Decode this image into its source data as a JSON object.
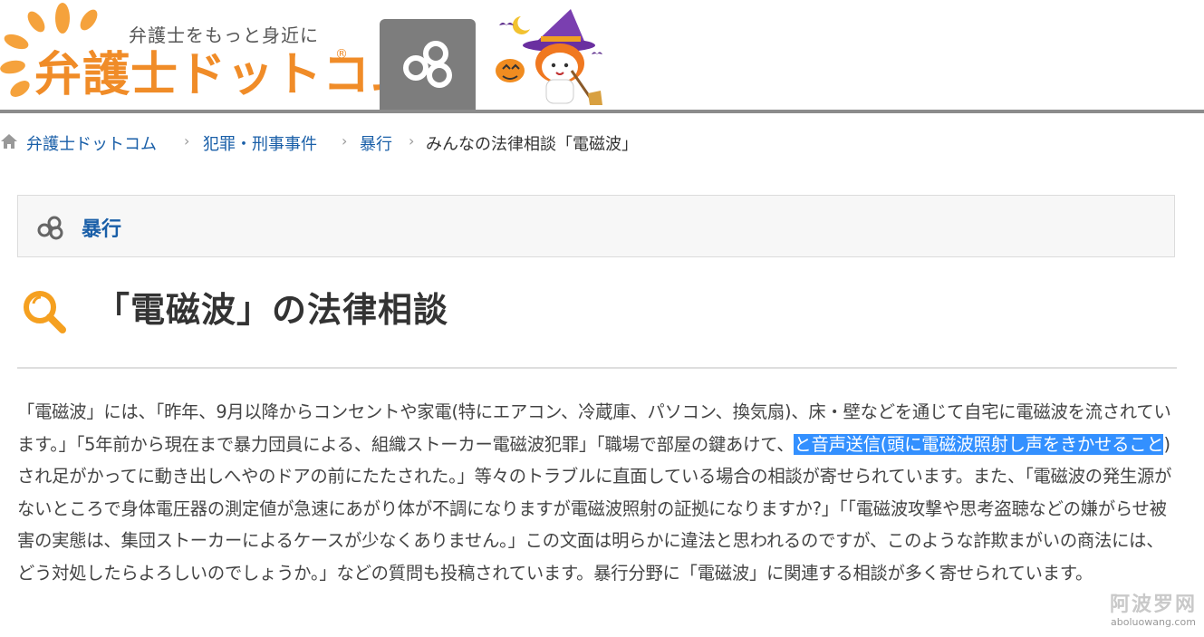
{
  "header": {
    "logo_tagline": "弁護士をもっと身近に",
    "logo_title": "弁護士ドットコム",
    "logo_reg": "®",
    "icon_button": "category-rings-icon",
    "mascot": "halloween-mascot"
  },
  "breadcrumb": {
    "home_icon": "home-icon",
    "items": [
      "弁護士ドットコム",
      "犯罪・刑事事件",
      "暴行"
    ],
    "separator": "›",
    "current": "みんなの法律相談「電磁波」"
  },
  "category": {
    "icon": "category-rings-icon",
    "label": "暴行"
  },
  "heading": {
    "icon": "search-icon",
    "title": "「電磁波」の法律相談"
  },
  "body": {
    "text_before": "「電磁波」には、「昨年、9月以降からコンセントや家電(特にエアコン、冷蔵庫、パソコン、換気扇)、床・壁などを通じて自宅に電磁波を流されています。」「5年前から現在まで暴力団員による、組織ストーカー電磁波犯罪」「職場で部屋の鍵あけて、",
    "highlighted": "と音声送信(頭に電磁波照射し声をきかせること",
    "text_after": ")され足がかってに動き出しへやのドアの前にたたされた。」等々のトラブルに直面している場合の相談が寄せられています。また、「電磁波の発生源がないところで身体電圧器の測定値が急速にあがり体が不調になりますが電磁波照射の証拠になりますか?」「「電磁波攻撃や思考盗聴などの嫌がらせ被害の実態は、集団ストーカーによるケースが少なくありません。」この文面は明らかに違法と思われるのですが、このような詐欺まがいの商法には、どう対処したらよろしいのでしょうか。」などの質問も投稿されています。暴行分野に「電磁波」に関連する相談が多く寄せられています。"
  },
  "watermark": {
    "title": "阿波罗网",
    "url": "aboluowang.com"
  },
  "colors": {
    "brand_orange": "#f08c28",
    "link_blue": "#1a5fa8",
    "header_gray": "#7d7d7d",
    "selection_blue": "#3390ff"
  }
}
